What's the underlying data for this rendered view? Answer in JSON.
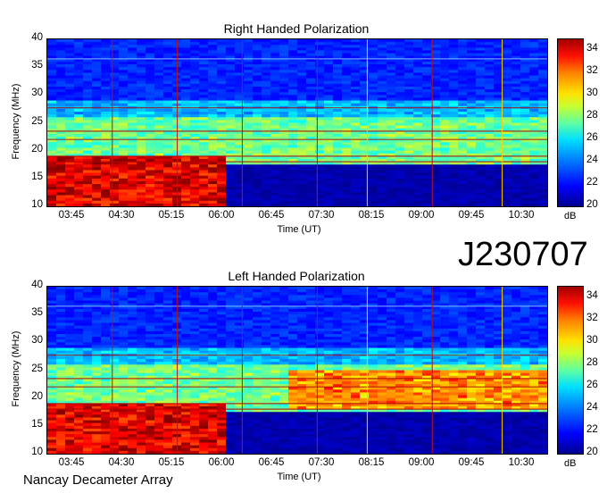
{
  "chart_data": [
    {
      "type": "heatmap",
      "title": "Right Handed Polarization",
      "xlabel": "Time (UT)",
      "ylabel": "Frequency (MHz)",
      "x_ticks": [
        "03:45",
        "04:30",
        "05:15",
        "06:00",
        "06:45",
        "07:30",
        "08:15",
        "09:00",
        "09:45",
        "10:30"
      ],
      "y_ticks": [
        "10",
        "15",
        "20",
        "25",
        "30",
        "35",
        "40"
      ],
      "ylim": [
        10,
        40
      ],
      "colorbar": {
        "label": "dB",
        "ticks": [
          "20",
          "22",
          "24",
          "26",
          "28",
          "30",
          "32",
          "34"
        ],
        "range": [
          20,
          35
        ]
      }
    },
    {
      "type": "heatmap",
      "title": "Left Handed Polarization",
      "xlabel": "Time (UT)",
      "ylabel": "Frequency (MHz)",
      "x_ticks": [
        "03:45",
        "04:30",
        "05:15",
        "06:00",
        "06:45",
        "07:30",
        "08:15",
        "09:00",
        "09:45",
        "10:30"
      ],
      "y_ticks": [
        "10",
        "15",
        "20",
        "25",
        "30",
        "35",
        "40"
      ],
      "ylim": [
        10,
        40
      ],
      "colorbar": {
        "label": "dB",
        "ticks": [
          "20",
          "22",
          "24",
          "26",
          "28",
          "30",
          "32",
          "34"
        ],
        "range": [
          20,
          35
        ]
      }
    }
  ],
  "observation_id": "J230707",
  "instrument": "Nancay Decameter Array"
}
